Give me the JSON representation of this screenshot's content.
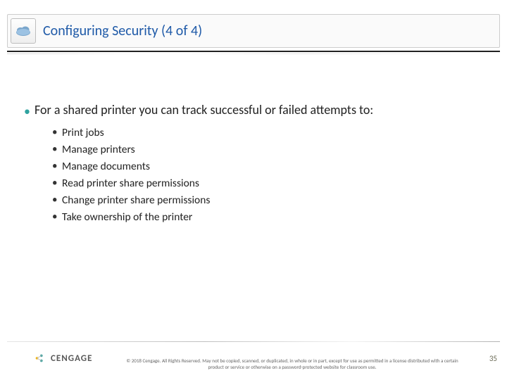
{
  "header": {
    "title": "Configuring Security (4 of 4)",
    "icon": "cloud-icon"
  },
  "body": {
    "lead": "For a shared printer you can track successful or failed attempts to:",
    "items": [
      "Print jobs",
      "Manage printers",
      "Manage documents",
      "Read printer share permissions",
      "Change printer share permissions",
      "Take ownership of the printer"
    ]
  },
  "footer": {
    "brand": "CENGAGE",
    "copyright": "© 2018 Cengage. All Rights Reserved. May not be copied, scanned, or duplicated, in whole or in part, except for use as permitted in a license distributed with a certain product or service or otherwise on a password-protected website for classroom use.",
    "page": "35"
  }
}
